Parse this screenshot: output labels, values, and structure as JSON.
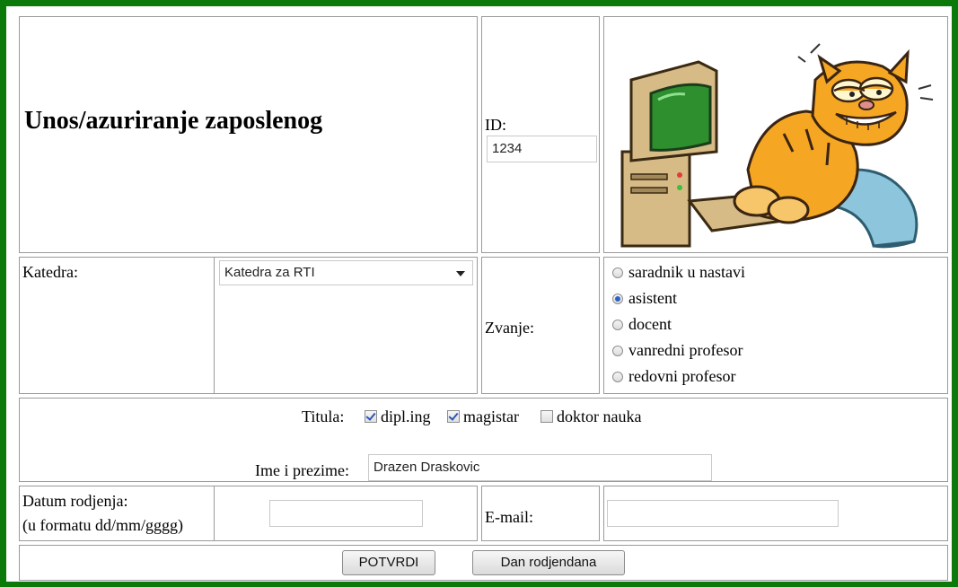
{
  "form": {
    "title": "Unos/azuriranje zaposlenog",
    "id_label": "ID:",
    "id_value": "1234",
    "katedra_label": "Katedra:",
    "katedra_selected": "Katedra za RTI",
    "zvanje_label": "Zvanje:",
    "zvanje_options": [
      {
        "label": "saradnik u nastavi",
        "selected": false
      },
      {
        "label": "asistent",
        "selected": true
      },
      {
        "label": "docent",
        "selected": false
      },
      {
        "label": "vanredni profesor",
        "selected": false
      },
      {
        "label": "redovni profesor",
        "selected": false
      }
    ],
    "titula_label": "Titula:",
    "titula_options": [
      {
        "label": "dipl.ing",
        "checked": true
      },
      {
        "label": "magistar",
        "checked": true
      },
      {
        "label": "doktor nauka",
        "checked": false
      }
    ],
    "ime_label": "Ime i prezime:",
    "ime_value": "Drazen Draskovic",
    "datum_label_line1": "Datum rodjenja:",
    "datum_label_line2": "(u formatu dd/mm/gggg)",
    "datum_value": "",
    "email_label": "E-mail:",
    "email_value": "",
    "submit_label": "POTVRDI",
    "birthday_label": "Dan rodjendana"
  },
  "colors": {
    "frame": "#0b7a0b",
    "radio_selected": "#2a62c9",
    "check_mark": "#2a55b8"
  }
}
